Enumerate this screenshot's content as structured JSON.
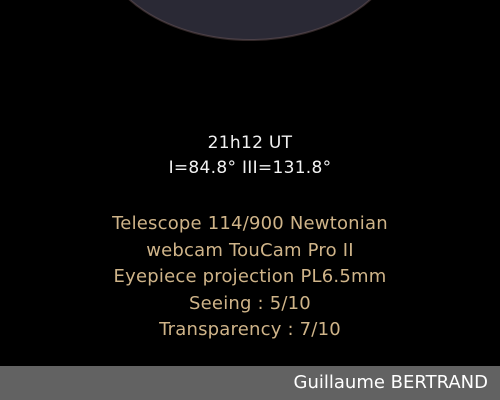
{
  "observation": {
    "time": "21h12 UT",
    "longitudes": "I=84.8° III=131.8°"
  },
  "setup": {
    "telescope": "Telescope 114/900 Newtonian",
    "camera": "webcam TouCam Pro II",
    "eyepiece": "Eyepiece projection PL6.5mm",
    "seeing": "Seeing : 5/10",
    "transparency": "Transparency : 7/10"
  },
  "credit": {
    "author": "Guillaume BERTRAND"
  },
  "colors": {
    "background": "#000000",
    "time_text": "#f2f2f2",
    "info_text": "#cfb489",
    "credit_bar": "#626262",
    "credit_text": "#ffffff"
  }
}
